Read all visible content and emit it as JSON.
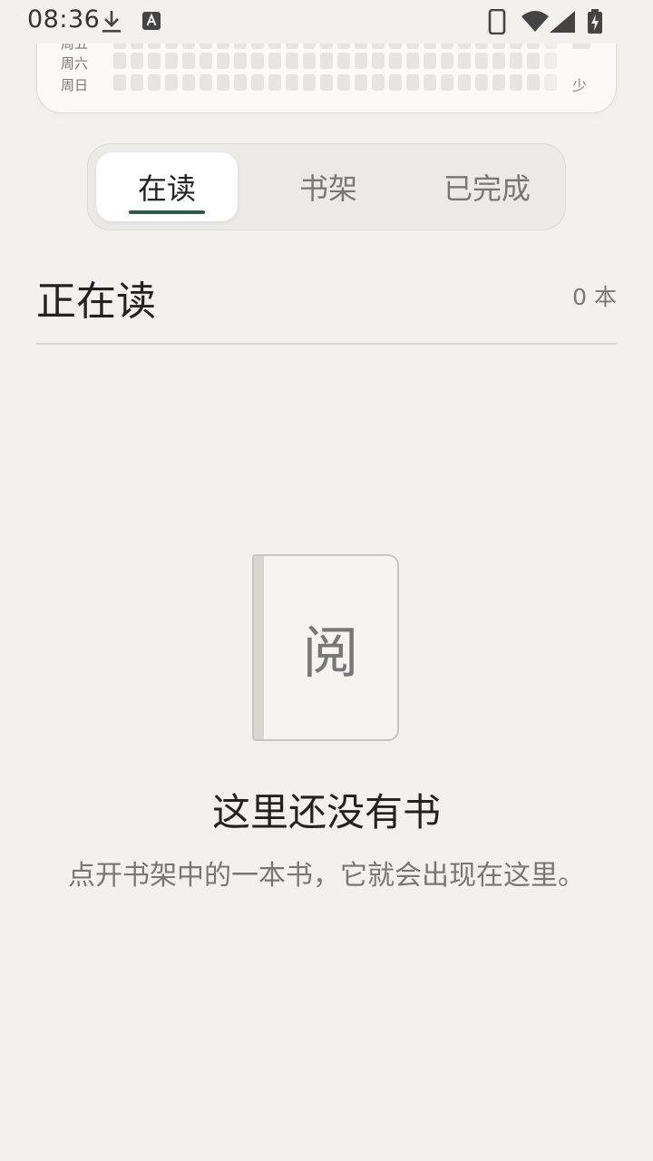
{
  "status_bar": {
    "time": "08:36",
    "icons": [
      "download-icon",
      "text-a-icon",
      "phone-icon",
      "wifi-icon",
      "signal-icon",
      "battery-charging-icon"
    ]
  },
  "heatmap": {
    "day_labels": [
      "周五",
      "周六",
      "周日"
    ],
    "legend_less": "少"
  },
  "tabs": [
    {
      "label": "在读",
      "active": true
    },
    {
      "label": "书架",
      "active": false
    },
    {
      "label": "已完成",
      "active": false
    }
  ],
  "section": {
    "title": "正在读",
    "count": "0 本"
  },
  "empty_state": {
    "book_char": "阅",
    "title": "这里还没有书",
    "description": "点开书架中的一本书，它就会出现在这里。"
  },
  "colors": {
    "background": "#f2f1ed",
    "accent": "#2f5a47",
    "tab_track": "#ebeae6"
  }
}
